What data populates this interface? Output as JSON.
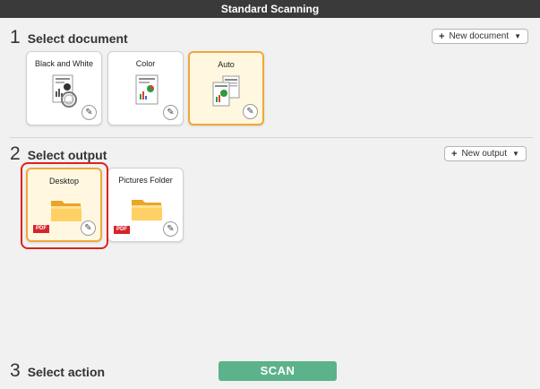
{
  "window": {
    "title": "Standard Scanning"
  },
  "documents": {
    "step_number": "1",
    "heading": "Select document",
    "new_button_label": "New document",
    "cards": [
      {
        "label": "Black and White",
        "selected": false
      },
      {
        "label": "Color",
        "selected": false
      },
      {
        "label": "Auto",
        "selected": true
      }
    ]
  },
  "outputs": {
    "step_number": "2",
    "heading": "Select output",
    "new_button_label": "New output",
    "cards": [
      {
        "label": "Desktop",
        "badge": "PDF",
        "selected": true
      },
      {
        "label": "Pictures Folder",
        "badge": "PDF",
        "selected": false
      }
    ]
  },
  "actions": {
    "step_number": "3",
    "heading": "Select action",
    "scan_label": "SCAN"
  },
  "colors": {
    "accent_selected": "#f0a83a",
    "highlight": "#e02020",
    "scan_button": "#5cb28b",
    "title_bar": "#3a3a3a"
  }
}
